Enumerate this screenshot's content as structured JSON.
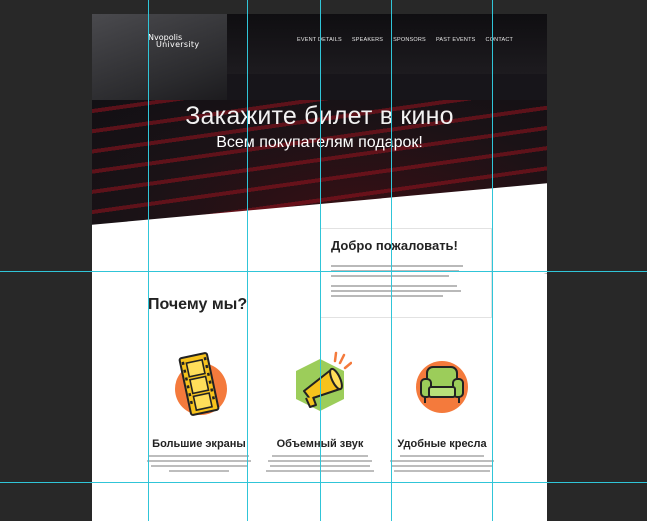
{
  "logo": {
    "line1": "Nvopolis",
    "line2": "University"
  },
  "nav": [
    "EVENT DETAILS",
    "SPEAKERS",
    "SPONSORS",
    "PAST EVENTS",
    "CONTACT"
  ],
  "hero": {
    "title": "Закажите билет в кино",
    "subtitle": "Всем покупателям подарок!"
  },
  "welcome": {
    "title": "Добро пожаловать!"
  },
  "why": {
    "title": "Почему мы?"
  },
  "features": [
    {
      "title": "Большие экраны",
      "icon": "film-strip-icon"
    },
    {
      "title": "Объемный звук",
      "icon": "megaphone-icon"
    },
    {
      "title": "Удобные кресла",
      "icon": "armchair-icon"
    }
  ],
  "colors": {
    "accent_orange": "#f47a3c",
    "guide": "#30c5d8",
    "film_yellow": "#f6c21c",
    "armchair_green": "#9ccd5a"
  }
}
